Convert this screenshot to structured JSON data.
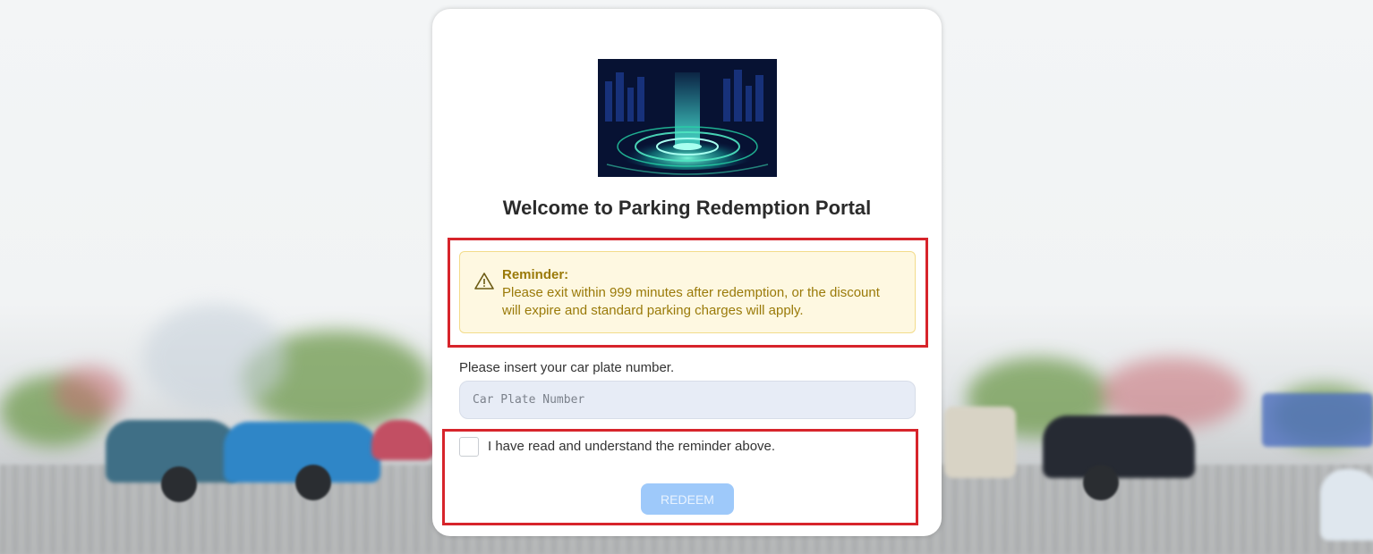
{
  "portal": {
    "title": "Welcome to Parking Redemption Portal"
  },
  "reminder": {
    "icon": "warning-icon",
    "heading": "Reminder:",
    "text": "Please exit within 999 minutes after redemption, or the discount will expire and standard parking charges will apply."
  },
  "form": {
    "plate_label": "Please insert your car plate number.",
    "plate_placeholder": "Car Plate Number",
    "plate_value": "",
    "acknowledge_label": "I have read and understand the reminder above.",
    "acknowledge_checked": false,
    "redeem_label": "REDEEM"
  },
  "colors": {
    "reminder_bg": "#fef8e1",
    "reminder_text": "#9a7a09",
    "highlight_border": "#d7242b",
    "button_disabled": "#9ec9fa"
  }
}
